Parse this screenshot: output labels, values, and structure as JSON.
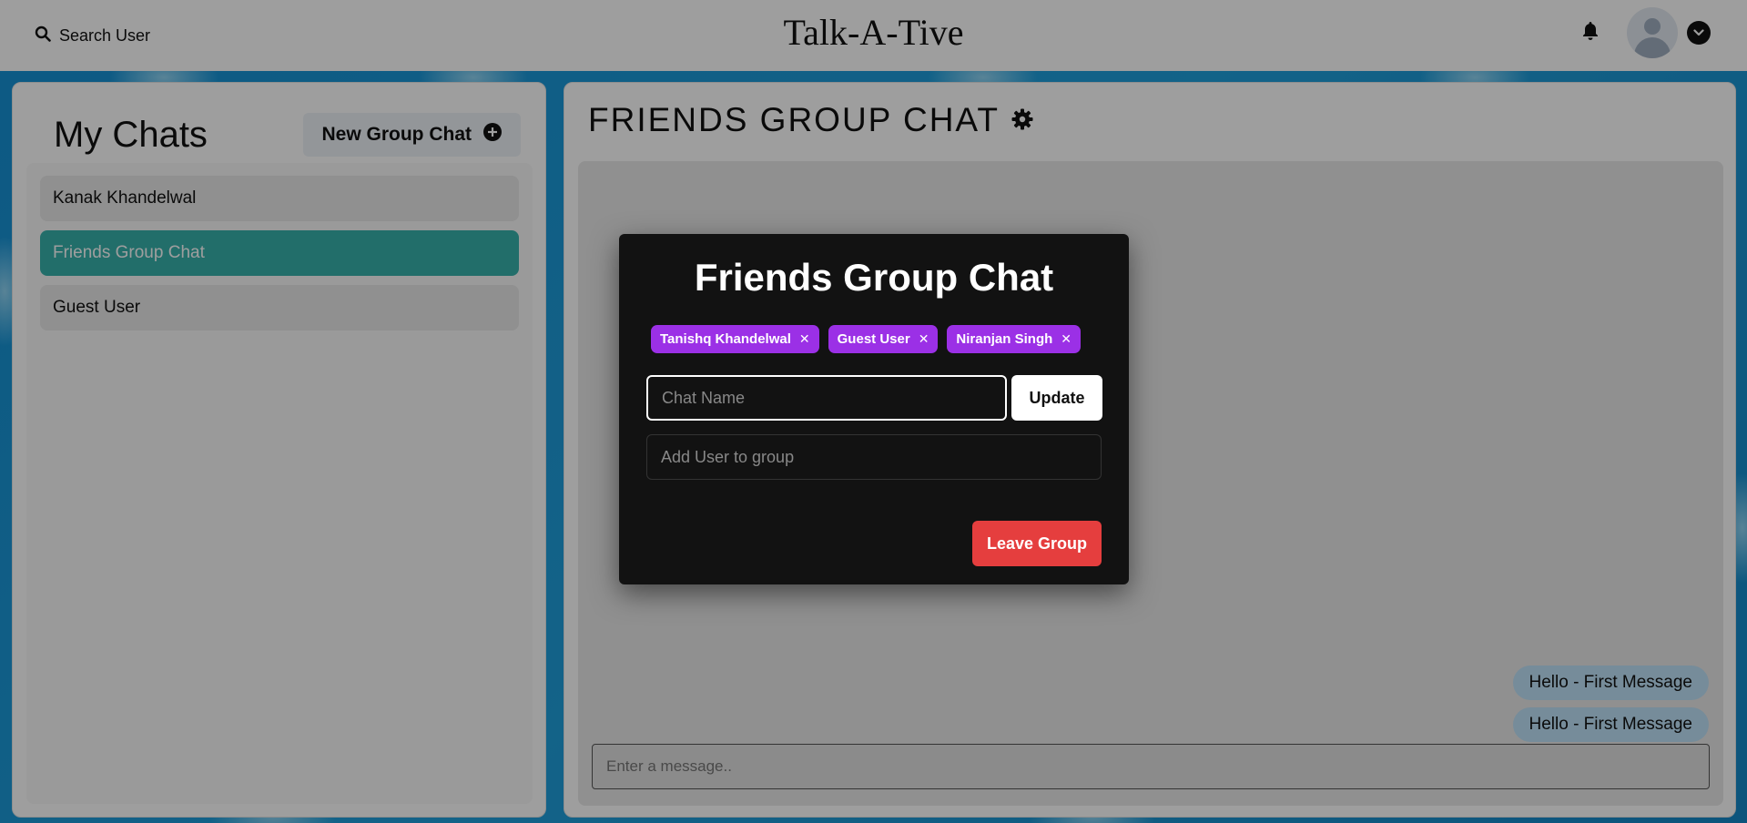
{
  "topbar": {
    "search_label": "Search User",
    "app_title": "Talk-A-Tive"
  },
  "chats": {
    "title": "My Chats",
    "new_group_label": "New Group Chat",
    "items": [
      {
        "label": "Kanak Khandelwal",
        "active": false
      },
      {
        "label": "Friends Group Chat",
        "active": true
      },
      {
        "label": "Guest User",
        "active": false
      }
    ]
  },
  "chat": {
    "header_title": "FRIENDS GROUP CHAT",
    "messages": [
      {
        "text": "Hello - First Message"
      },
      {
        "text": "Hello - First Message"
      }
    ],
    "input_placeholder": "Enter a message.."
  },
  "modal": {
    "title": "Friends Group Chat",
    "members": [
      {
        "name": "Tanishq Khandelwal"
      },
      {
        "name": "Guest User"
      },
      {
        "name": "Niranjan Singh"
      }
    ],
    "remove_glyph": "✕",
    "chat_name_placeholder": "Chat Name",
    "update_label": "Update",
    "add_user_placeholder": "Add User to group",
    "leave_label": "Leave Group"
  },
  "colors": {
    "active_chat": "#38b2ac",
    "badge": "#9b30e6",
    "leave_button": "#e53e3e",
    "message_bubble": "#bee3f8"
  }
}
